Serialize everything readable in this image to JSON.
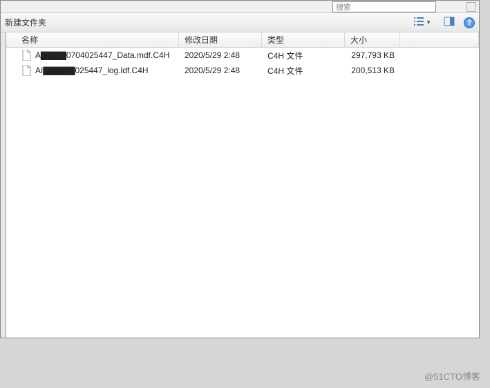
{
  "topbar": {
    "search_text": "搜索"
  },
  "toolbar": {
    "new_folder": "新建文件夹"
  },
  "columns": {
    "name": "名称",
    "date": "修改日期",
    "type": "类型",
    "size": "大小"
  },
  "files": [
    {
      "name": "A▇▇▇▇0704025447_Data.mdf.C4H",
      "date": "2020/5/29 2:48",
      "type": "C4H 文件",
      "size": "297,793 KB"
    },
    {
      "name": "AI▇▇▇▇▇025447_log.ldf.C4H",
      "date": "2020/5/29 2:48",
      "type": "C4H 文件",
      "size": "200,513 KB"
    }
  ],
  "watermark": "@51CTO博客"
}
